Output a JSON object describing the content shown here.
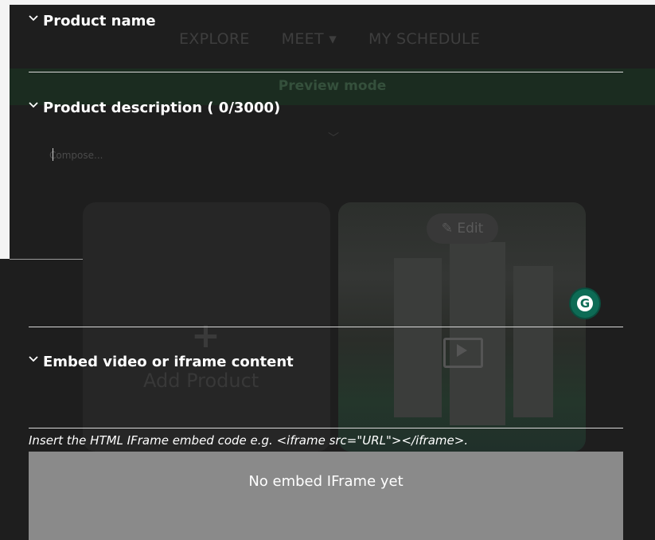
{
  "background": {
    "nav": [
      "EXPLORE",
      "MEET ▾",
      "MY SCHEDULE"
    ],
    "preview_banner": "Preview mode",
    "compose_placeholder": "Compose...",
    "add_product": "Add Product",
    "edit_button": "Edit"
  },
  "form": {
    "product_name": {
      "label": "Product name"
    },
    "product_description": {
      "label": "Product description ( 0/3000)"
    },
    "embed": {
      "label": "Embed video or iframe content",
      "hint": "Insert the HTML IFrame embed code e.g. <iframe src=\"URL\"></iframe>.",
      "empty_state": "No embed IFrame yet"
    }
  },
  "colors": {
    "modal_bg": "#1e1e1e",
    "embed_box": "#8a8a8a",
    "grammarly": "#0d6b55"
  },
  "icons": {
    "chevron": "chevron-down-icon",
    "grammarly": "grammarly-icon",
    "pencil": "pencil-icon",
    "video": "video-icon"
  }
}
